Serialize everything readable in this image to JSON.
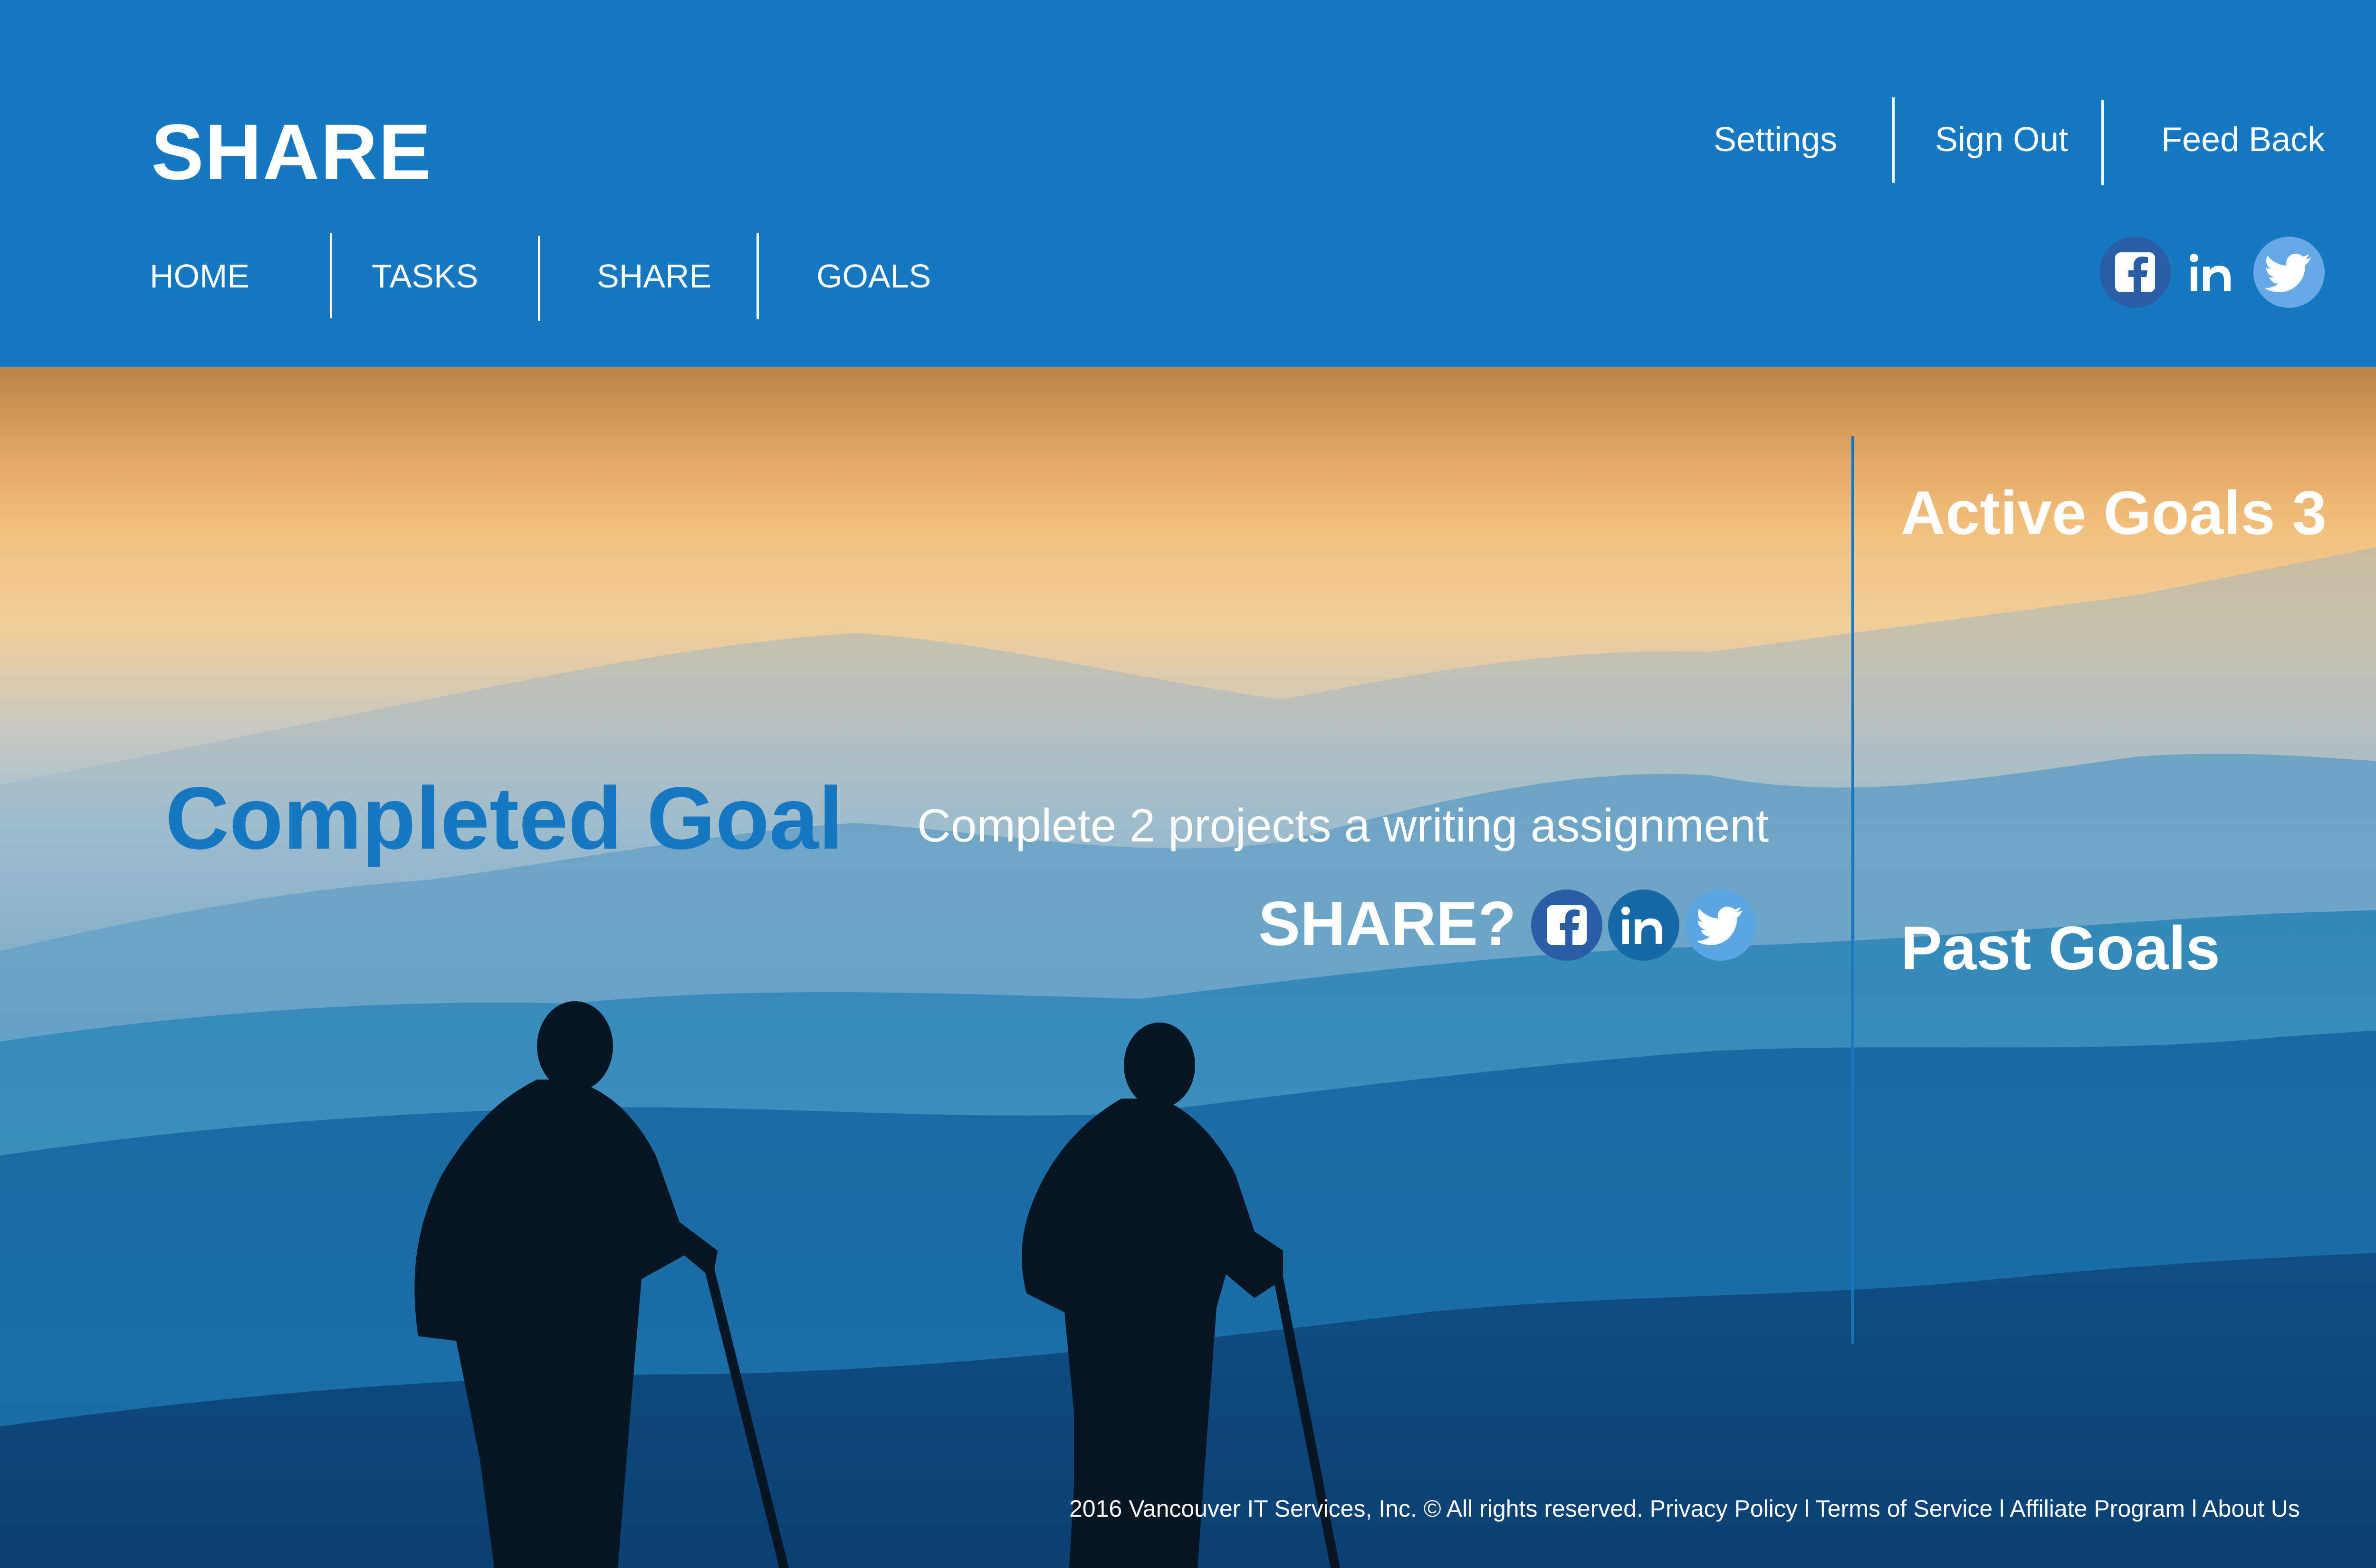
{
  "header": {
    "logo": "SHARE",
    "top_links": [
      "Settings",
      "Sign Out",
      "Feed Back"
    ],
    "nav": [
      "HOME",
      "TASKS",
      "SHARE",
      "GOALS"
    ],
    "social_icons": [
      "facebook-icon",
      "linkedin-icon",
      "twitter-icon"
    ]
  },
  "hero": {
    "completed_title": "Completed Goal",
    "goal_description": "Complete 2 projects a writing assignment",
    "share_prompt": "SHARE?",
    "share_icons": [
      "facebook-icon",
      "linkedin-icon",
      "twitter-icon"
    ]
  },
  "sidebar": {
    "active_goals": "Active Goals 3",
    "past_goals": "Past Goals"
  },
  "footer": {
    "copyright": "2016 Vancouver IT Services, Inc. © All rights reserved.",
    "links": [
      "Privacy Policy",
      "Terms of Service",
      "Affiliate Program",
      "About Us"
    ],
    "separator": "l"
  },
  "colors": {
    "brand_blue": "#1677c2",
    "facebook": "#3b5998",
    "linkedin": "#1668a7",
    "twitter": "#55acee"
  }
}
